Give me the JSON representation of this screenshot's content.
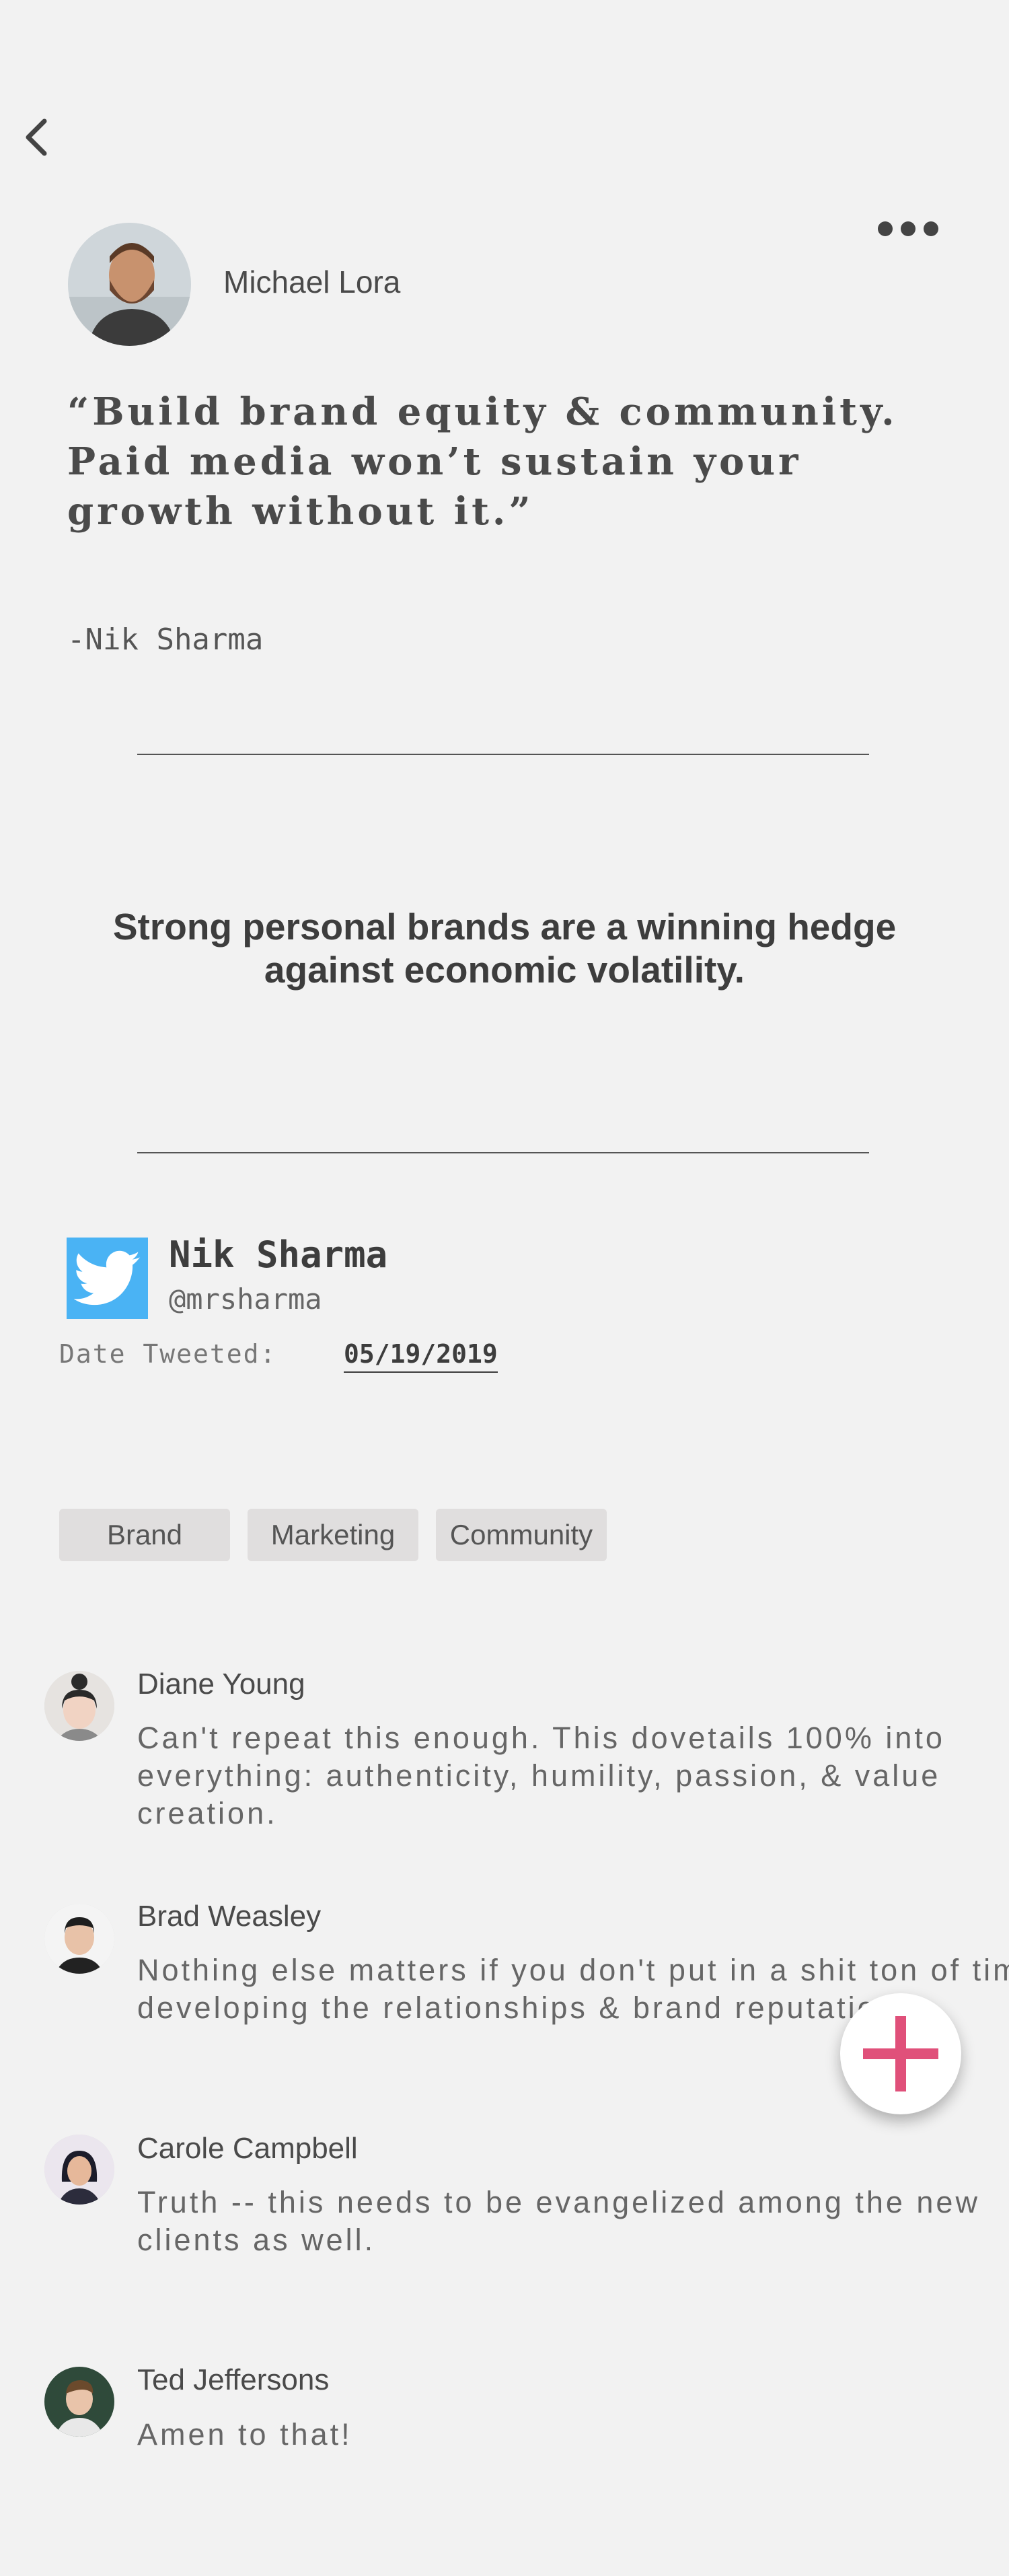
{
  "author": {
    "name": "Michael Lora"
  },
  "post": {
    "quote": "“Build brand equity & community. Paid media won’t sustain your growth without it.”",
    "attribution": "-Nik Sharma",
    "headline": "Strong personal brands are a winning hedge against economic volatility."
  },
  "tweet": {
    "name": "Nik Sharma",
    "handle": "@mrsharma",
    "date_label": "Date Tweeted:",
    "date": "05/19/2019"
  },
  "tags": [
    "Brand",
    "Marketing",
    "Community"
  ],
  "comments": [
    {
      "name": "Diane Young",
      "text": "Can't repeat this enough. This dovetails 100% into everything: authenticity, humility, passion, & value creation."
    },
    {
      "name": "Brad Weasley",
      "text": "Nothing else matters if you don't put in a shit ton of time developing the relationships & brand reputation."
    },
    {
      "name": "Carole Campbell",
      "text": "Truth -- this needs to be evangelized among the new clients as well."
    },
    {
      "name": "Ted Jeffersons",
      "text": "Amen to that!"
    }
  ],
  "colors": {
    "background": "#f2f2f2",
    "twitter": "#4ab3f4",
    "fab_plus": "#e0507a",
    "tag_bg": "#e0dede"
  },
  "icons": {
    "back": "chevron-left-icon",
    "more": "more-horizontal-icon",
    "twitter": "twitter-bird-icon",
    "add": "plus-icon"
  }
}
